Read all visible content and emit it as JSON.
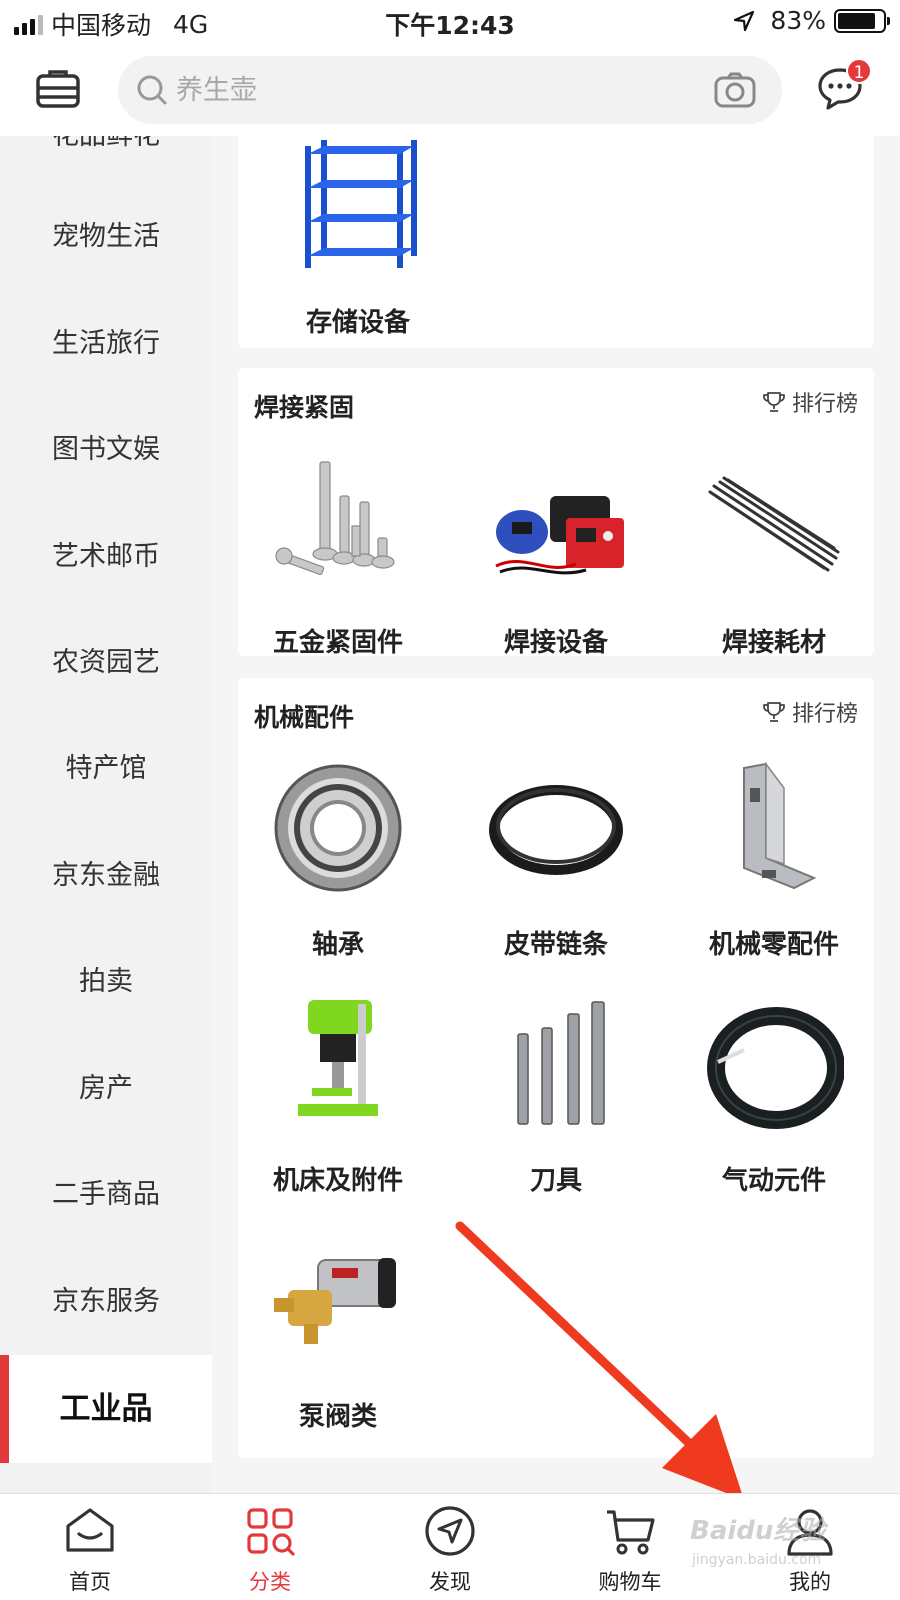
{
  "status_bar": {
    "carrier": "中国移动",
    "network": "4G",
    "time": "下午12:43",
    "battery_pct": "83%",
    "battery_level": 0.83
  },
  "header": {
    "search_placeholder": "养生壶",
    "message_badge": "1",
    "icons": [
      "menu-icon",
      "search-icon",
      "camera-icon",
      "message-icon"
    ]
  },
  "sidebar": {
    "partial_top_item": "花品鲜花",
    "items": [
      "宠物生活",
      "生活旅行",
      "图书文娱",
      "艺术邮币",
      "农资园艺",
      "特产馆",
      "京东金融",
      "拍卖",
      "房产",
      "二手商品",
      "京东服务"
    ],
    "active_item": "工业品"
  },
  "sections": {
    "storage": {
      "items": [
        "存储设备"
      ]
    },
    "welding": {
      "title": "焊接紧固",
      "rank_label": "排行榜",
      "items": [
        "五金紧固件",
        "焊接设备",
        "焊接耗材"
      ]
    },
    "mechanical": {
      "title": "机械配件",
      "rank_label": "排行榜",
      "items": [
        "轴承",
        "皮带链条",
        "机械零配件",
        "机床及附件",
        "刀具",
        "气动元件",
        "泵阀类"
      ]
    }
  },
  "tabbar": {
    "tabs": [
      "首页",
      "分类",
      "发现",
      "购物车",
      "我的"
    ],
    "active": "分类"
  },
  "watermark": {
    "brand": "Baidu经验",
    "url": "jingyan.baidu.com"
  },
  "colors": {
    "accent": "#e4393c",
    "arrow": "#f03a1f"
  }
}
